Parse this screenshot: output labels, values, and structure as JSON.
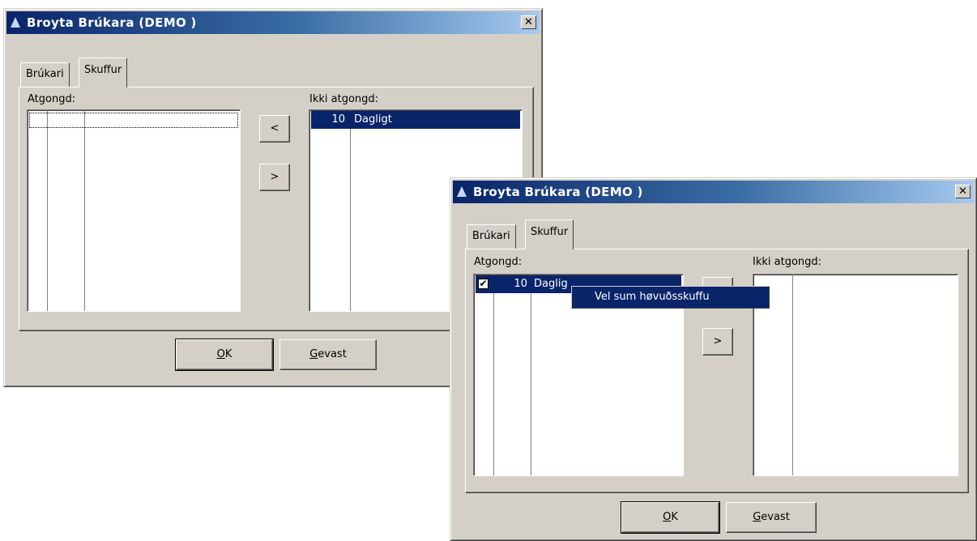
{
  "dialog1": {
    "title": "Broyta Brúkara (DEMO )",
    "close_glyph": "✕",
    "tabs": [
      {
        "label": "Brúkari"
      },
      {
        "label": "Skuffur"
      }
    ],
    "left_list": {
      "label": "Atgongd:",
      "rows": []
    },
    "right_list": {
      "label": "Ikki atgongd:",
      "rows": [
        {
          "num": "10",
          "name": "Dagligt",
          "selected": true
        }
      ]
    },
    "move_left_button": "<",
    "move_right_button": ">",
    "ok_button": {
      "underline": "O",
      "rest": "K"
    },
    "cancel_button": {
      "underline": "G",
      "rest": "evast"
    }
  },
  "dialog2": {
    "title": "Broyta Brúkara (DEMO )",
    "close_glyph": "✕",
    "tabs": [
      {
        "label": "Brúkari"
      },
      {
        "label": "Skuffur"
      }
    ],
    "left_list": {
      "label": "Atgongd:",
      "rows": [
        {
          "checked": true,
          "check_glyph": "✔",
          "num": "10",
          "name": "Daglig",
          "selected": true
        }
      ]
    },
    "right_list": {
      "label": "Ikki atgongd:",
      "rows": []
    },
    "move_right_button": ">",
    "context_menu": {
      "items": [
        {
          "label": "Vel sum høvuðsskuffu"
        }
      ]
    },
    "ok_button": {
      "underline": "O",
      "rest": "K"
    },
    "cancel_button": {
      "underline": "G",
      "rest": "evast"
    }
  },
  "colors": {
    "title_active": "#0a246a",
    "title_gradient_end": "#a6caf0",
    "face": "#d4d0c8",
    "selection": "#0a246a"
  }
}
